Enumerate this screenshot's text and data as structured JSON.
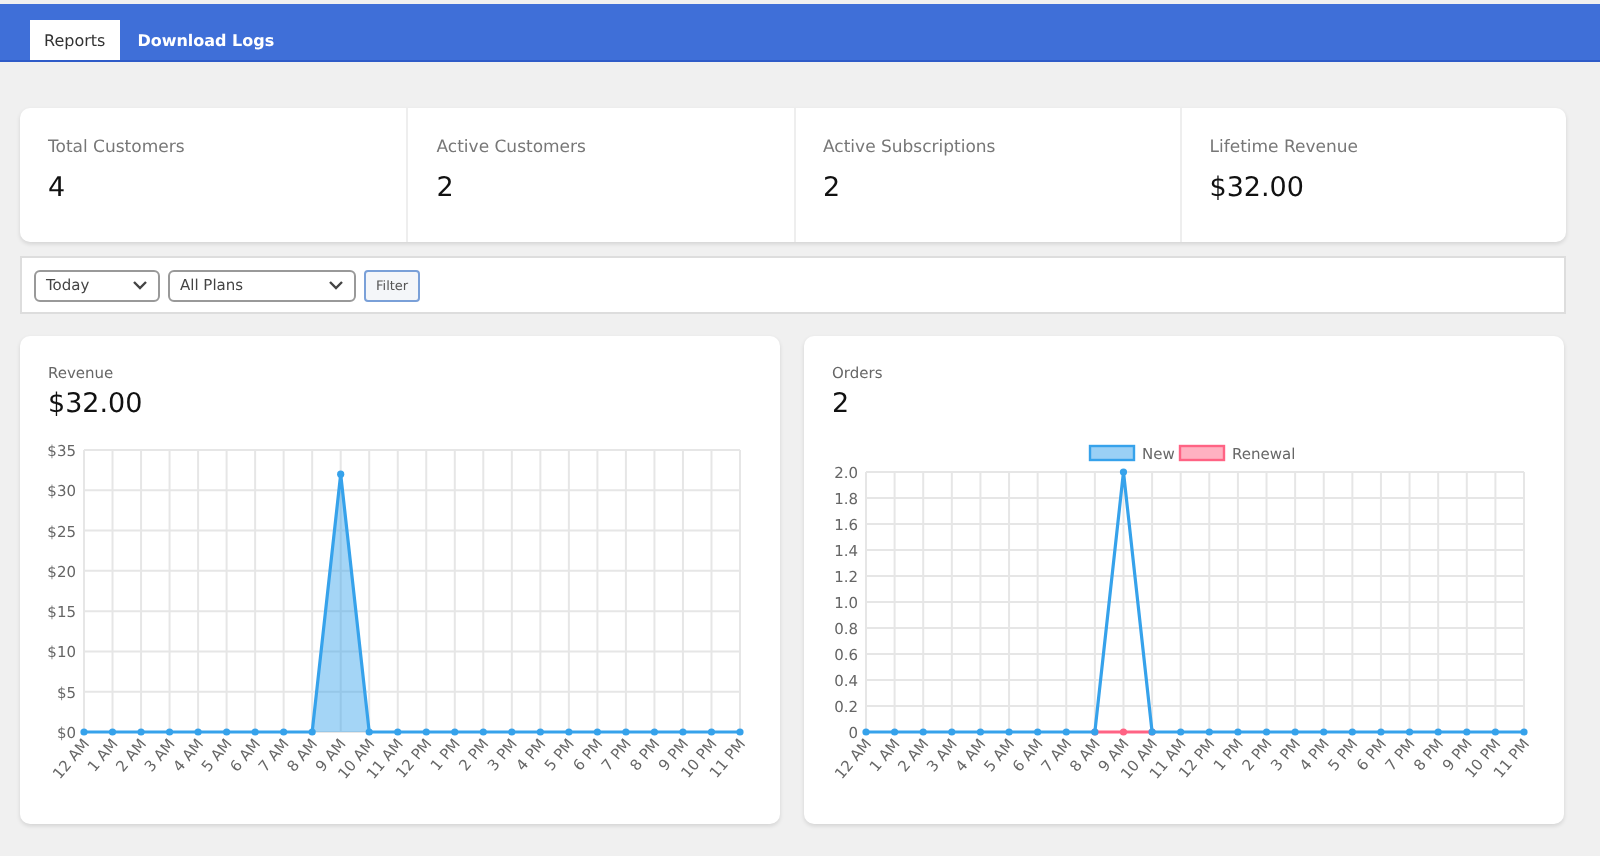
{
  "tabs": [
    {
      "label": "Reports",
      "selected": true
    },
    {
      "label": "Download Logs",
      "selected": false
    }
  ],
  "stats": [
    {
      "label": "Total Customers",
      "value": "4"
    },
    {
      "label": "Active Customers",
      "value": "2"
    },
    {
      "label": "Active Subscriptions",
      "value": "2"
    },
    {
      "label": "Lifetime Revenue",
      "value": "$32.00"
    }
  ],
  "filters": {
    "period": {
      "value": "Today"
    },
    "plan": {
      "value": "All Plans"
    },
    "button": "Filter"
  },
  "charts": [
    {
      "title": "Revenue",
      "total": "$32.00",
      "chart_data": {
        "type": "area",
        "grid": true,
        "categories": [
          "12 AM",
          "1 AM",
          "2 AM",
          "3 AM",
          "4 AM",
          "5 AM",
          "6 AM",
          "7 AM",
          "8 AM",
          "9 AM",
          "10 AM",
          "11 AM",
          "12 PM",
          "1 PM",
          "2 PM",
          "3 PM",
          "4 PM",
          "5 PM",
          "6 PM",
          "7 PM",
          "8 PM",
          "9 PM",
          "10 PM",
          "11 PM"
        ],
        "ylim": [
          0,
          35
        ],
        "yticks": [
          {
            "value": 0,
            "label": "$0"
          },
          {
            "value": 5,
            "label": "$5"
          },
          {
            "value": 10,
            "label": "$10"
          },
          {
            "value": 15,
            "label": "$15"
          },
          {
            "value": 20,
            "label": "$20"
          },
          {
            "value": 25,
            "label": "$25"
          },
          {
            "value": 30,
            "label": "$30"
          },
          {
            "value": 35,
            "label": "$35"
          }
        ],
        "series": [
          {
            "color": "#36a2eb",
            "marker": true,
            "values": [
              0,
              0,
              0,
              0,
              0,
              0,
              0,
              0,
              0,
              32,
              0,
              0,
              0,
              0,
              0,
              0,
              0,
              0,
              0,
              0,
              0,
              0,
              0,
              0
            ]
          }
        ]
      }
    },
    {
      "title": "Orders",
      "total": "2",
      "chart_data": {
        "type": "line",
        "grid": true,
        "legend": true,
        "categories": [
          "12 AM",
          "1 AM",
          "2 AM",
          "3 AM",
          "4 AM",
          "5 AM",
          "6 AM",
          "7 AM",
          "8 AM",
          "9 AM",
          "10 AM",
          "11 AM",
          "12 PM",
          "1 PM",
          "2 PM",
          "3 PM",
          "4 PM",
          "5 PM",
          "6 PM",
          "7 PM",
          "8 PM",
          "9 PM",
          "10 PM",
          "11 PM"
        ],
        "ylim": [
          0,
          2
        ],
        "yticks": [
          {
            "value": 0,
            "label": "0"
          },
          {
            "value": 0.2,
            "label": "0.2"
          },
          {
            "value": 0.4,
            "label": "0.4"
          },
          {
            "value": 0.6,
            "label": "0.6"
          },
          {
            "value": 0.8,
            "label": "0.8"
          },
          {
            "value": 1,
            "label": "1.0"
          },
          {
            "value": 1.2,
            "label": "1.2"
          },
          {
            "value": 1.4,
            "label": "1.4"
          },
          {
            "value": 1.6,
            "label": "1.6"
          },
          {
            "value": 1.8,
            "label": "1.8"
          },
          {
            "value": 2,
            "label": "2.0"
          }
        ],
        "series": [
          {
            "name": "New",
            "color": "#36a2eb",
            "marker": true,
            "values": [
              0,
              0,
              0,
              0,
              0,
              0,
              0,
              0,
              0,
              2,
              0,
              0,
              0,
              0,
              0,
              0,
              0,
              0,
              0,
              0,
              0,
              0,
              0,
              0
            ]
          },
          {
            "name": "Renewal",
            "color": "#ff6384",
            "marker": true,
            "values": [
              null,
              null,
              null,
              null,
              null,
              null,
              null,
              null,
              0,
              0,
              0,
              null,
              null,
              null,
              null,
              null,
              null,
              null,
              null,
              null,
              null,
              null,
              null,
              null
            ]
          }
        ]
      }
    }
  ]
}
